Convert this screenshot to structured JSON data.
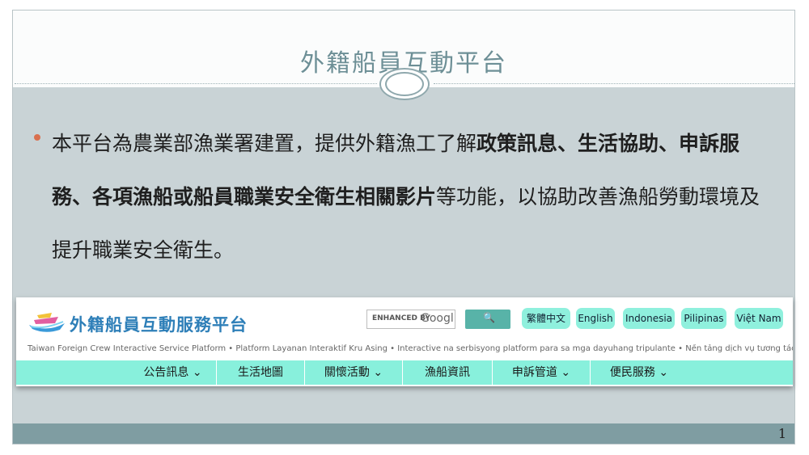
{
  "slide": {
    "title": "外籍船員互動平台",
    "body_parts": [
      {
        "text": "本平台為農業部漁業署建置，提供外籍漁工了解",
        "bold": false
      },
      {
        "text": "政策訊息、生活協助、申訴服務、各項漁船或船員職業安全衛生相關影片",
        "bold": true
      },
      {
        "text": "等功能，以協助改善漁船勞動環境及提升職業安全衛生。",
        "bold": false
      }
    ],
    "page_number": "1",
    "colors": {
      "title": "#6d8f96",
      "bullet": "#d9704f",
      "background": "#c9d3d6",
      "footer": "#7f9da2"
    }
  },
  "site": {
    "logo_text": "外籍船員互動服務平台",
    "logo_icon": "ship-icon",
    "search": {
      "hint": "ENHANCED BY",
      "brand": "Googl",
      "button_icon": "search-icon"
    },
    "languages": [
      "繁體中文",
      "English",
      "Indonesia",
      "Pilipinas",
      "Việt Nam"
    ],
    "tagline": "Taiwan Foreign Crew Interactive Service Platform • Platform Layanan Interaktif Kru Asing • Interactive na serbisyong platform para sa mga dayuhang tripulante • Nền tảng dịch vụ tương tác dành cho thuyền viên nước ngoài",
    "nav": [
      "公告訊息 ⌄",
      "生活地圖",
      "關懷活動 ⌄",
      "漁船資訊",
      "申訴管道 ⌄",
      "便民服務 ⌄"
    ],
    "colors": {
      "nav": "#88f0dc",
      "lang_button": "#8ff0dd",
      "logo_text": "#2e7fb8",
      "search_button": "#58b3a8"
    }
  }
}
